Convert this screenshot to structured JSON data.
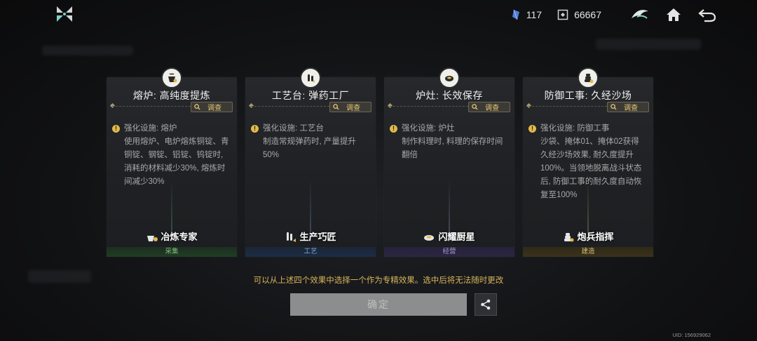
{
  "header": {
    "resources": [
      {
        "icon": "crystal-icon",
        "value": "117"
      },
      {
        "icon": "supply-crate-icon",
        "value": "66667"
      }
    ]
  },
  "cards": [
    {
      "title": "熔炉: 高纯度提炼",
      "inspect_label": "调查",
      "effect_head": "强化设施: 熔炉",
      "effect_body": "使用熔炉、电炉熔炼铜锭、青铜锭、钢锭、铝锭、钨锭时, 消耗的材料减少30%, 熔炼时间减少30%",
      "badge": "冶炼专家",
      "category": "采集",
      "category_color": "#1f3a22",
      "category_text_color": "#7fbf7f",
      "beam_color": "#6fbf8f"
    },
    {
      "title": "工艺台: 弹药工厂",
      "inspect_label": "调查",
      "effect_head": "强化设施: 工艺台",
      "effect_body": "制造常规弹药时, 产量提升50%",
      "badge": "生产巧匠",
      "category": "工艺",
      "category_color": "#1c2c44",
      "category_text_color": "#7fa6d6",
      "beam_color": "#7fa6d6"
    },
    {
      "title": "炉灶: 长效保存",
      "inspect_label": "调查",
      "effect_head": "强化设施: 炉灶",
      "effect_body": "制作料理时, 料理的保存时间翻倍",
      "badge": "闪耀厨星",
      "category": "经营",
      "category_color": "#2c2640",
      "category_text_color": "#a89ad6",
      "beam_color": "#a89ad6"
    },
    {
      "title": "防御工事: 久经沙场",
      "inspect_label": "调查",
      "effect_head": "强化设施: 防御工事",
      "effect_body": "沙袋、掩体01、掩体02获得久经沙场效果, 耐久度提升100%。当领地脱离战斗状态后, 防御工事的耐久度自动恢复至100%",
      "badge": "炮兵指挥",
      "category": "建造",
      "category_color": "#3a321a",
      "category_text_color": "#d6bf73",
      "beam_color": "#d6bf73"
    }
  ],
  "footer": {
    "hint": "可以从上述四个效果中选择一个作为专精效果。选中后将无法随时更改",
    "confirm_label": "确定",
    "uid": "UID: 156929062"
  },
  "colors": {
    "accent": "#e8c973",
    "hint": "#d8b45a"
  }
}
